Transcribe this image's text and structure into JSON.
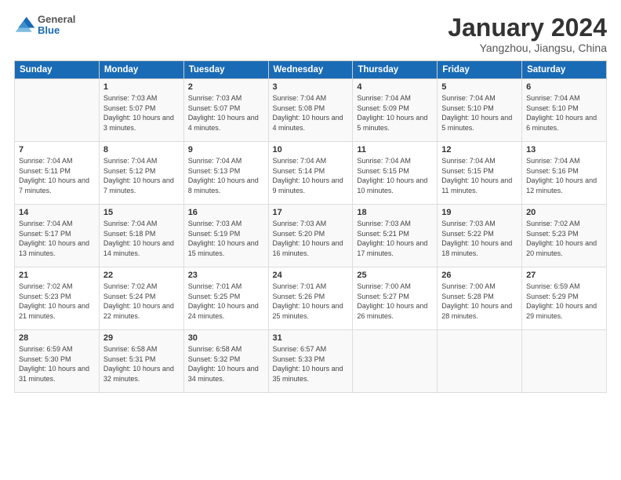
{
  "header": {
    "logo_general": "General",
    "logo_blue": "Blue",
    "month_title": "January 2024",
    "location": "Yangzhou, Jiangsu, China"
  },
  "days_of_week": [
    "Sunday",
    "Monday",
    "Tuesday",
    "Wednesday",
    "Thursday",
    "Friday",
    "Saturday"
  ],
  "weeks": [
    [
      {
        "num": "",
        "sunrise": "",
        "sunset": "",
        "daylight": ""
      },
      {
        "num": "1",
        "sunrise": "Sunrise: 7:03 AM",
        "sunset": "Sunset: 5:07 PM",
        "daylight": "Daylight: 10 hours and 3 minutes."
      },
      {
        "num": "2",
        "sunrise": "Sunrise: 7:03 AM",
        "sunset": "Sunset: 5:07 PM",
        "daylight": "Daylight: 10 hours and 4 minutes."
      },
      {
        "num": "3",
        "sunrise": "Sunrise: 7:04 AM",
        "sunset": "Sunset: 5:08 PM",
        "daylight": "Daylight: 10 hours and 4 minutes."
      },
      {
        "num": "4",
        "sunrise": "Sunrise: 7:04 AM",
        "sunset": "Sunset: 5:09 PM",
        "daylight": "Daylight: 10 hours and 5 minutes."
      },
      {
        "num": "5",
        "sunrise": "Sunrise: 7:04 AM",
        "sunset": "Sunset: 5:10 PM",
        "daylight": "Daylight: 10 hours and 5 minutes."
      },
      {
        "num": "6",
        "sunrise": "Sunrise: 7:04 AM",
        "sunset": "Sunset: 5:10 PM",
        "daylight": "Daylight: 10 hours and 6 minutes."
      }
    ],
    [
      {
        "num": "7",
        "sunrise": "Sunrise: 7:04 AM",
        "sunset": "Sunset: 5:11 PM",
        "daylight": "Daylight: 10 hours and 7 minutes."
      },
      {
        "num": "8",
        "sunrise": "Sunrise: 7:04 AM",
        "sunset": "Sunset: 5:12 PM",
        "daylight": "Daylight: 10 hours and 7 minutes."
      },
      {
        "num": "9",
        "sunrise": "Sunrise: 7:04 AM",
        "sunset": "Sunset: 5:13 PM",
        "daylight": "Daylight: 10 hours and 8 minutes."
      },
      {
        "num": "10",
        "sunrise": "Sunrise: 7:04 AM",
        "sunset": "Sunset: 5:14 PM",
        "daylight": "Daylight: 10 hours and 9 minutes."
      },
      {
        "num": "11",
        "sunrise": "Sunrise: 7:04 AM",
        "sunset": "Sunset: 5:15 PM",
        "daylight": "Daylight: 10 hours and 10 minutes."
      },
      {
        "num": "12",
        "sunrise": "Sunrise: 7:04 AM",
        "sunset": "Sunset: 5:15 PM",
        "daylight": "Daylight: 10 hours and 11 minutes."
      },
      {
        "num": "13",
        "sunrise": "Sunrise: 7:04 AM",
        "sunset": "Sunset: 5:16 PM",
        "daylight": "Daylight: 10 hours and 12 minutes."
      }
    ],
    [
      {
        "num": "14",
        "sunrise": "Sunrise: 7:04 AM",
        "sunset": "Sunset: 5:17 PM",
        "daylight": "Daylight: 10 hours and 13 minutes."
      },
      {
        "num": "15",
        "sunrise": "Sunrise: 7:04 AM",
        "sunset": "Sunset: 5:18 PM",
        "daylight": "Daylight: 10 hours and 14 minutes."
      },
      {
        "num": "16",
        "sunrise": "Sunrise: 7:03 AM",
        "sunset": "Sunset: 5:19 PM",
        "daylight": "Daylight: 10 hours and 15 minutes."
      },
      {
        "num": "17",
        "sunrise": "Sunrise: 7:03 AM",
        "sunset": "Sunset: 5:20 PM",
        "daylight": "Daylight: 10 hours and 16 minutes."
      },
      {
        "num": "18",
        "sunrise": "Sunrise: 7:03 AM",
        "sunset": "Sunset: 5:21 PM",
        "daylight": "Daylight: 10 hours and 17 minutes."
      },
      {
        "num": "19",
        "sunrise": "Sunrise: 7:03 AM",
        "sunset": "Sunset: 5:22 PM",
        "daylight": "Daylight: 10 hours and 18 minutes."
      },
      {
        "num": "20",
        "sunrise": "Sunrise: 7:02 AM",
        "sunset": "Sunset: 5:23 PM",
        "daylight": "Daylight: 10 hours and 20 minutes."
      }
    ],
    [
      {
        "num": "21",
        "sunrise": "Sunrise: 7:02 AM",
        "sunset": "Sunset: 5:23 PM",
        "daylight": "Daylight: 10 hours and 21 minutes."
      },
      {
        "num": "22",
        "sunrise": "Sunrise: 7:02 AM",
        "sunset": "Sunset: 5:24 PM",
        "daylight": "Daylight: 10 hours and 22 minutes."
      },
      {
        "num": "23",
        "sunrise": "Sunrise: 7:01 AM",
        "sunset": "Sunset: 5:25 PM",
        "daylight": "Daylight: 10 hours and 24 minutes."
      },
      {
        "num": "24",
        "sunrise": "Sunrise: 7:01 AM",
        "sunset": "Sunset: 5:26 PM",
        "daylight": "Daylight: 10 hours and 25 minutes."
      },
      {
        "num": "25",
        "sunrise": "Sunrise: 7:00 AM",
        "sunset": "Sunset: 5:27 PM",
        "daylight": "Daylight: 10 hours and 26 minutes."
      },
      {
        "num": "26",
        "sunrise": "Sunrise: 7:00 AM",
        "sunset": "Sunset: 5:28 PM",
        "daylight": "Daylight: 10 hours and 28 minutes."
      },
      {
        "num": "27",
        "sunrise": "Sunrise: 6:59 AM",
        "sunset": "Sunset: 5:29 PM",
        "daylight": "Daylight: 10 hours and 29 minutes."
      }
    ],
    [
      {
        "num": "28",
        "sunrise": "Sunrise: 6:59 AM",
        "sunset": "Sunset: 5:30 PM",
        "daylight": "Daylight: 10 hours and 31 minutes."
      },
      {
        "num": "29",
        "sunrise": "Sunrise: 6:58 AM",
        "sunset": "Sunset: 5:31 PM",
        "daylight": "Daylight: 10 hours and 32 minutes."
      },
      {
        "num": "30",
        "sunrise": "Sunrise: 6:58 AM",
        "sunset": "Sunset: 5:32 PM",
        "daylight": "Daylight: 10 hours and 34 minutes."
      },
      {
        "num": "31",
        "sunrise": "Sunrise: 6:57 AM",
        "sunset": "Sunset: 5:33 PM",
        "daylight": "Daylight: 10 hours and 35 minutes."
      },
      {
        "num": "",
        "sunrise": "",
        "sunset": "",
        "daylight": ""
      },
      {
        "num": "",
        "sunrise": "",
        "sunset": "",
        "daylight": ""
      },
      {
        "num": "",
        "sunrise": "",
        "sunset": "",
        "daylight": ""
      }
    ]
  ]
}
